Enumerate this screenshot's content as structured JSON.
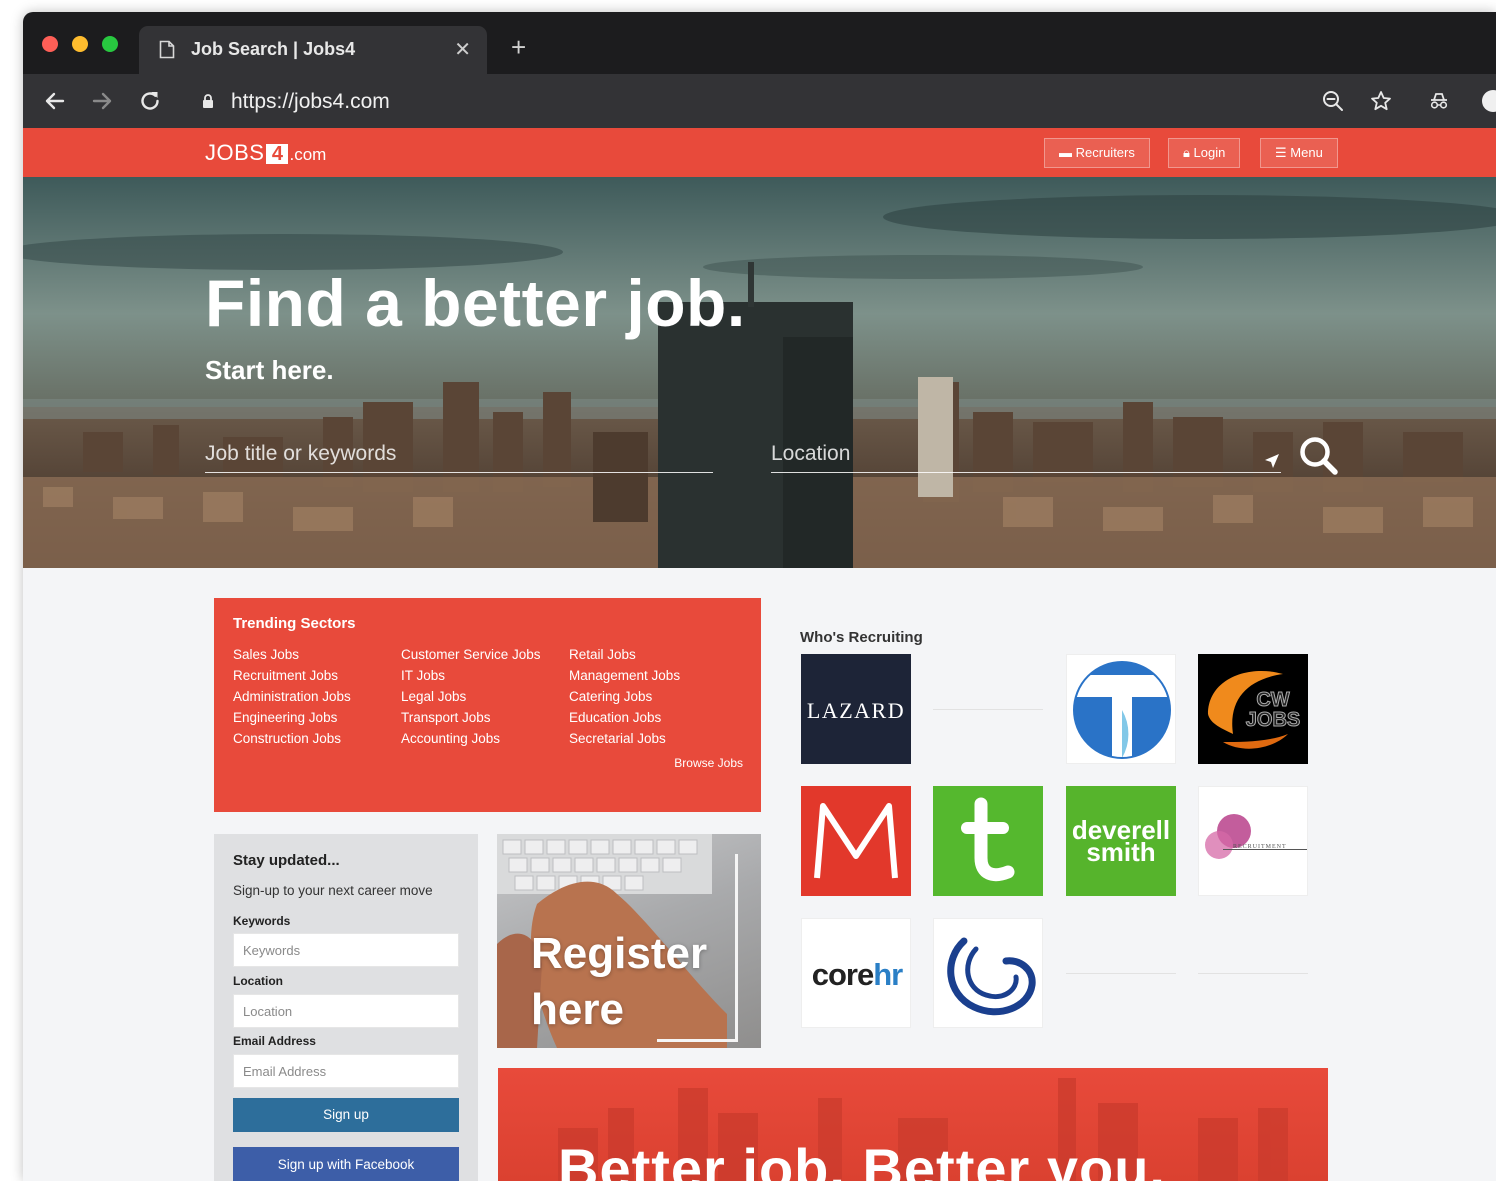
{
  "browser": {
    "tab_title": "Job Search | Jobs4",
    "url": "https://jobs4.com"
  },
  "header": {
    "logo_jobs": "JOBS",
    "logo_four": "4",
    "logo_com": ".com",
    "buttons": [
      {
        "label": "Recruiters",
        "icon": "briefcase-icon"
      },
      {
        "label": "Login",
        "icon": "lock-icon"
      },
      {
        "label": "Menu",
        "icon": "hamburger-icon"
      }
    ]
  },
  "hero": {
    "title": "Find a better job.",
    "subtitle": "Start here.",
    "keywords_placeholder": "Job title or keywords",
    "location_placeholder": "Location"
  },
  "sectors": {
    "title": "Trending Sectors",
    "columns": [
      [
        "Sales Jobs",
        "Recruitment Jobs",
        "Administration Jobs",
        "Engineering Jobs",
        "Construction Jobs"
      ],
      [
        "Customer Service Jobs",
        "IT Jobs",
        "Legal Jobs",
        "Transport Jobs",
        "Accounting Jobs"
      ],
      [
        "Retail Jobs",
        "Management Jobs",
        "Catering Jobs",
        "Education Jobs",
        "Secretarial Jobs"
      ]
    ],
    "browse_label": "Browse Jobs"
  },
  "signup": {
    "title": "Stay updated...",
    "subtitle": "Sign-up to your next career move",
    "keywords_label": "Keywords",
    "keywords_placeholder": "Keywords",
    "location_label": "Location",
    "location_placeholder": "Location",
    "email_label": "Email Address",
    "email_placeholder": "Email Address",
    "signup_button": "Sign up",
    "facebook_button": "Sign up with Facebook"
  },
  "register": {
    "line1": "Register",
    "line2": "here"
  },
  "recruiting": {
    "title": "Who's Recruiting",
    "logos": [
      {
        "name": "lazard",
        "text": "LAZARD"
      },
      {
        "name": "cwjobs",
        "text": "CW JOBS"
      },
      {
        "name": "deverell-smith",
        "text1": "deverell",
        "text2": "smith"
      },
      {
        "name": "recruitment-logo",
        "text": "RECRUITMENT"
      },
      {
        "name": "corehr",
        "text1": "core",
        "text2": "hr"
      }
    ]
  },
  "banner": {
    "text": "Better job. Better you."
  },
  "colors": {
    "brand_red": "#e84a3b",
    "signup_blue": "#2d6e9b",
    "facebook_blue": "#3d5ea8"
  }
}
